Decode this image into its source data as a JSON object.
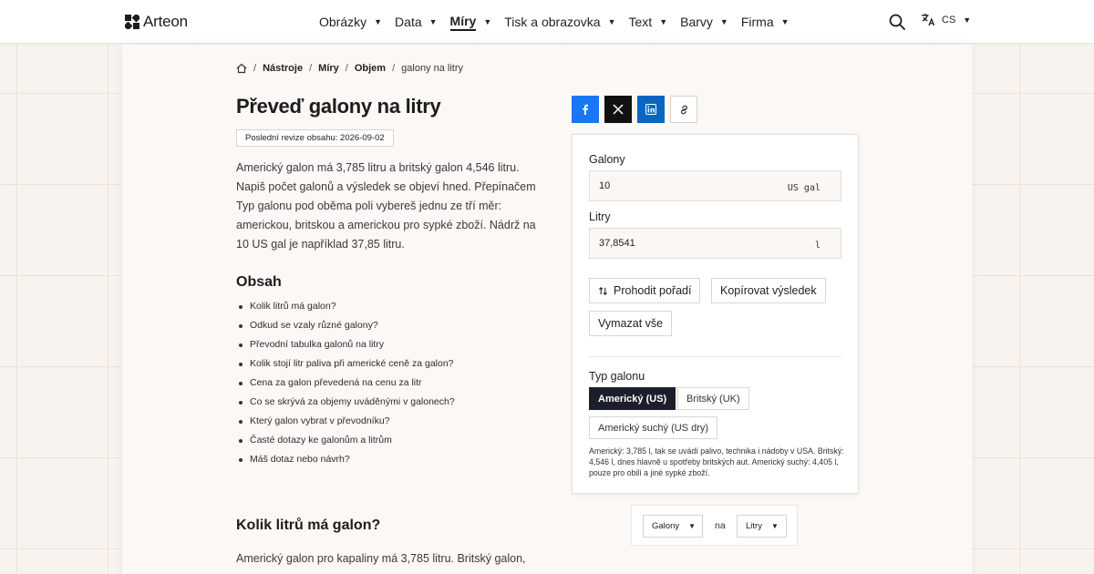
{
  "header": {
    "logo_text": "Arteon",
    "nav": [
      {
        "label": "Obrázky",
        "active": false
      },
      {
        "label": "Data",
        "active": false
      },
      {
        "label": "Míry",
        "active": true
      },
      {
        "label": "Tisk a obrazovka",
        "active": false
      },
      {
        "label": "Text",
        "active": false
      },
      {
        "label": "Barvy",
        "active": false
      },
      {
        "label": "Firma",
        "active": false
      }
    ],
    "lang": "CS"
  },
  "breadcrumb": {
    "items": [
      "Nástroje",
      "Míry",
      "Objem"
    ],
    "current": "galony na litry"
  },
  "page": {
    "title": "Převeď galony na litry",
    "revision": "Poslední revize obsahu: 2026-09-02",
    "intro": "Americký galon má 3,785 litru a britský galon 4,546 litru. Napiš počet galonů a výsledek se objeví hned. Přepínačem Typ galonu pod oběma poli vybereš jednu ze tří měr: americkou, britskou a americkou pro sypké zboží. Nádrž na 10 US gal je například 37,85 litru."
  },
  "toc": {
    "title": "Obsah",
    "items": [
      "Kolik litrů má galon?",
      "Odkud se vzaly různé galony?",
      "Převodní tabulka galonů na litry",
      "Kolik stojí litr paliva při americké ceně za galon?",
      "Cena za galon převedená na cenu za litr",
      "Co se skrývá za objemy uváděnými v galonech?",
      "Který galon vybrat v převodníku?",
      "Časté dotazy ke galonům a litrům",
      "Máš dotaz nebo návrh?"
    ]
  },
  "section": {
    "title": "Kolik litrů má galon?",
    "text": "Americký galon pro kapaliny má 3,785 litru. Britský galon,"
  },
  "converter": {
    "from_label": "Galony",
    "from_value": "10",
    "from_unit": "US gal",
    "to_label": "Litry",
    "to_value": "37,8541",
    "to_unit": "l",
    "swap_label": "Prohodit pořadí",
    "copy_label": "Kopírovat výsledek",
    "clear_label": "Vymazat vše",
    "type_label": "Typ galonu",
    "types": [
      "Americký (US)",
      "Britský (UK)",
      "Americký suchý (US dry)"
    ],
    "selected_type": "Americký (US)",
    "type_note": "Americký: 3,785 l, tak se uvádí palivo, technika i nádoby v USA. Britský: 4,546 l, dnes hlavně u spotřeby britských aut. Americký suchý: 4,405 l, pouze pro obilí a jiné sypké zboží."
  },
  "unit_picker": {
    "from": "Galony",
    "connector": "na",
    "to": "Litry"
  },
  "colors": {
    "facebook": "#1877f2",
    "x": "#111111",
    "linkedin": "#0a66c2",
    "active_chip": "#1c1e2b"
  }
}
